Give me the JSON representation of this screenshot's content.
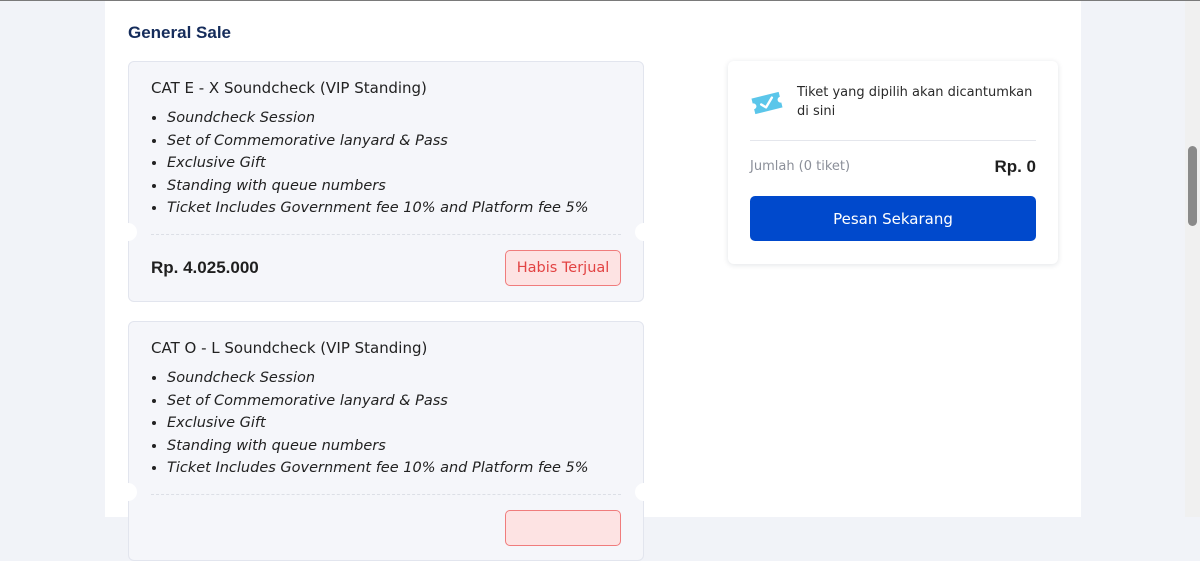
{
  "section": {
    "title": "General Sale"
  },
  "tickets": [
    {
      "name": "CAT E - X Soundcheck (VIP Standing)",
      "benefits": [
        "Soundcheck Session",
        "Set of Commemorative lanyard & Pass",
        "Exclusive Gift",
        "Standing with queue numbers",
        "Ticket Includes Government fee 10% and Platform fee 5%"
      ],
      "price": "Rp. 4.025.000",
      "status": "Habis Terjual"
    },
    {
      "name": "CAT O - L Soundcheck (VIP Standing)",
      "benefits": [
        "Soundcheck Session",
        "Set of Commemorative lanyard & Pass",
        "Exclusive Gift",
        "Standing with queue numbers",
        "Ticket Includes Government fee 10% and Platform fee 5%"
      ]
    }
  ],
  "summary": {
    "icon": "ticket-icon",
    "empty_text": "Tiket yang dipilih akan dicantumkan di sini",
    "quantity_label": "Jumlah (0 tiket)",
    "total": "Rp. 0",
    "order_button": "Pesan Sekarang"
  },
  "colors": {
    "primary": "#0049cc",
    "soldout_text": "#e24343",
    "soldout_bg": "#fde3e3",
    "title": "#152c5b",
    "icon": "#5bc6ea"
  }
}
